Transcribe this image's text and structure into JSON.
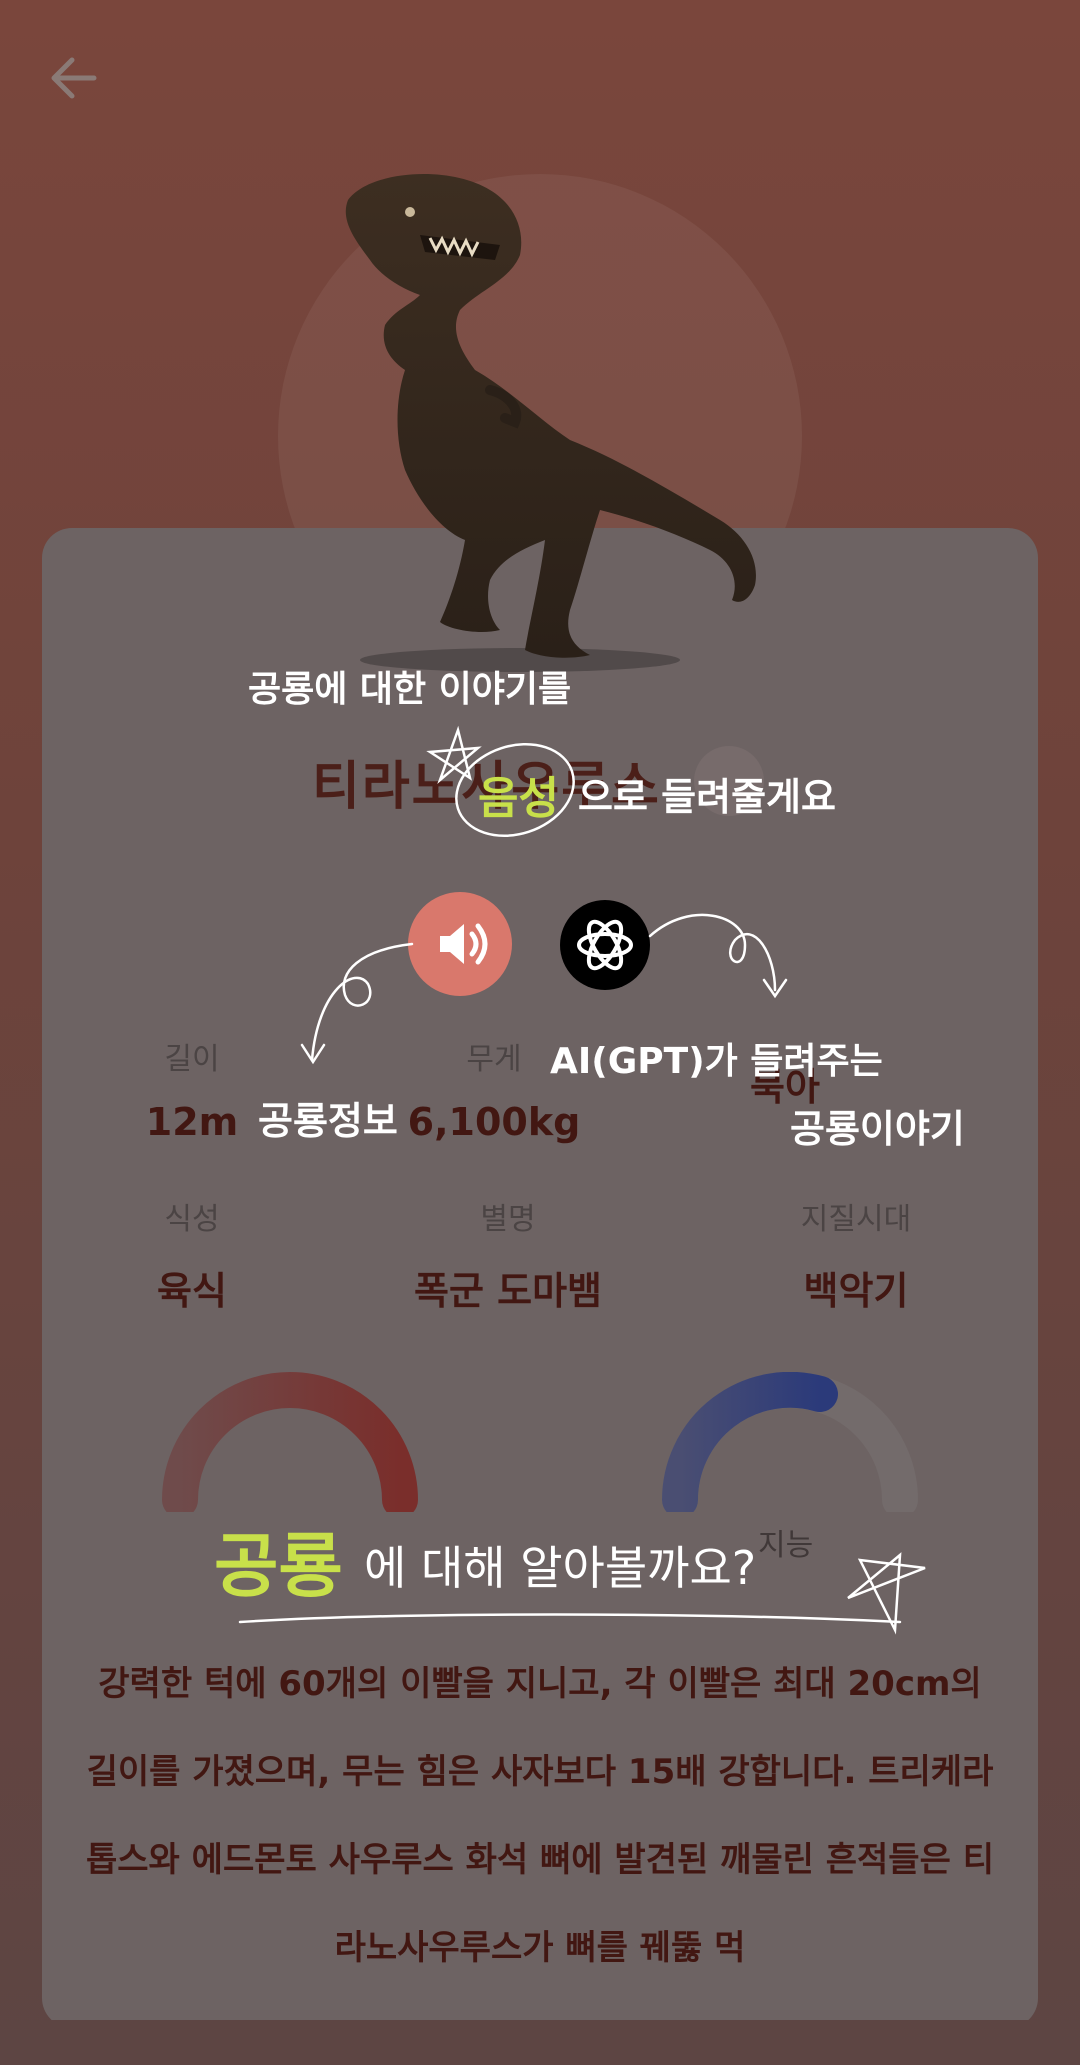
{
  "header": {
    "back_icon": "arrow-left-icon"
  },
  "dinosaur": {
    "name": "티라노사우루스",
    "stats": [
      {
        "label": "길이",
        "value": "12m"
      },
      {
        "label": "무게",
        "value": "6,100kg"
      },
      {
        "label": "",
        "value": "북아"
      },
      {
        "label": "식성",
        "value": "육식"
      },
      {
        "label": "별명",
        "value": "폭군 도마뱀"
      },
      {
        "label": "지질시대",
        "value": "백악기"
      }
    ],
    "gauges": [
      {
        "label": "",
        "level": 1.0,
        "color": "#7a2e2b"
      },
      {
        "label": "지능",
        "level": 0.6,
        "color": "#2b3a7a"
      }
    ],
    "description": "강력한 턱에 60개의 이빨을 지니고, 각 이빨은 최대 20cm의 길이를 가졌으며, 무는 힘은 사자보다 15배 강합니다. 트리케라톱스와 에드몬토 사우루스 화석 뼈에 발견된 깨물린 흔적들은 티라노사우루스가 뼈를 꿰뚫 먹"
  },
  "tutorial": {
    "line1": "공룡에 대한 이야기를",
    "voice_word": "음성",
    "line2_rest": "으로 들려줄게요",
    "sound_label": "공룡정보",
    "gpt_label_1": "AI(GPT)가 들려주는",
    "gpt_label_2": "공룡이야기",
    "headline_word": "공룡",
    "headline_rest": "에 대해 알아볼까요?"
  },
  "colors": {
    "accent": "#c8e04a",
    "sound_button": "#d9786c",
    "text_dark": "#421712"
  },
  "icons": {
    "sound": "speaker-icon",
    "gpt": "openai-logo-icon"
  }
}
